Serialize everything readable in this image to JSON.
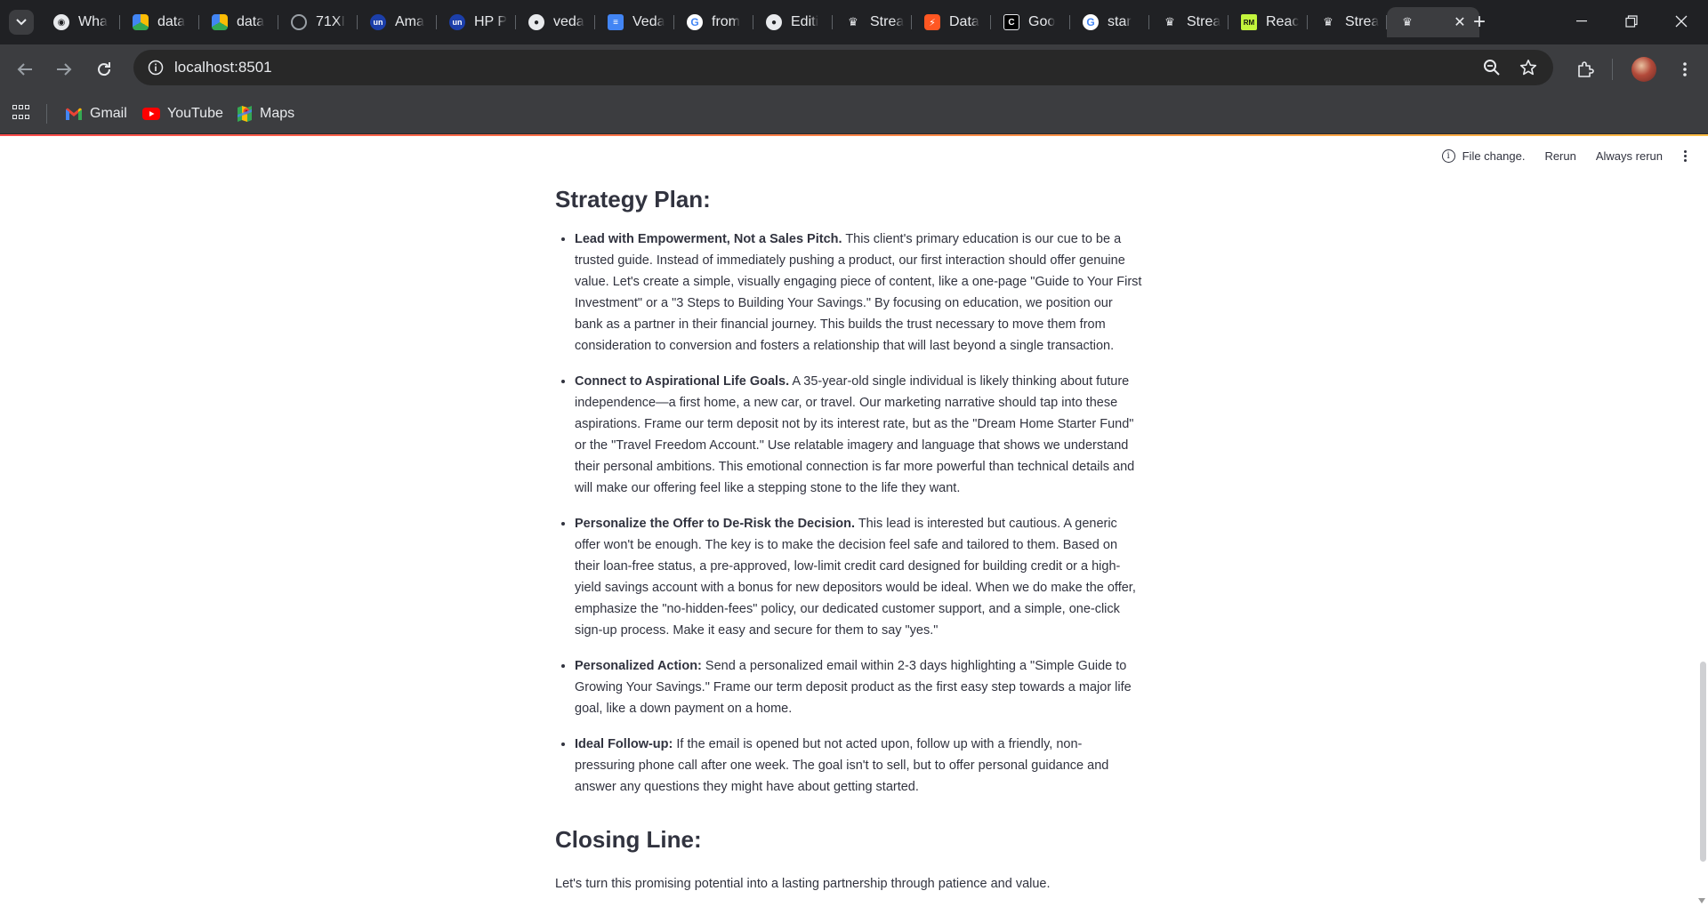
{
  "browser": {
    "tabs": [
      {
        "title": "Wha",
        "icon": "chrome-icon"
      },
      {
        "title": "data",
        "icon": "google-drive-icon"
      },
      {
        "title": "data",
        "icon": "google-drive-icon"
      },
      {
        "title": "71XI",
        "icon": "loading-icon"
      },
      {
        "title": "Ama",
        "icon": "unstop-icon"
      },
      {
        "title": "HP P",
        "icon": "unstop-icon"
      },
      {
        "title": "veda",
        "icon": "github-icon"
      },
      {
        "title": "Veda",
        "icon": "google-docs-icon"
      },
      {
        "title": "from",
        "icon": "google-icon"
      },
      {
        "title": "Editi",
        "icon": "github-icon"
      },
      {
        "title": "Strea",
        "icon": "streamlit-icon"
      },
      {
        "title": "Data",
        "icon": "bolt-icon"
      },
      {
        "title": "Goo",
        "icon": "notion-icon"
      },
      {
        "title": "star",
        "icon": "google-icon"
      },
      {
        "title": "Strea",
        "icon": "streamlit-icon"
      },
      {
        "title": "Reac",
        "icon": "rm-icon"
      },
      {
        "title": "Strea",
        "icon": "streamlit-icon"
      },
      {
        "title": "",
        "icon": "streamlit-icon"
      }
    ],
    "address": "localhost:8501",
    "bookmarks": [
      {
        "label": "Gmail",
        "icon": "gmail-icon"
      },
      {
        "label": "YouTube",
        "icon": "youtube-icon"
      },
      {
        "label": "Maps",
        "icon": "maps-icon"
      }
    ]
  },
  "status": {
    "message": "File change.",
    "rerun": "Rerun",
    "always_rerun": "Always rerun"
  },
  "content": {
    "strategy_heading": "Strategy Plan:",
    "items": [
      {
        "bold": "Lead with Empowerment, Not a Sales Pitch.",
        "text": " This client's primary education is our cue to be a trusted guide. Instead of immediately pushing a product, our first interaction should offer genuine value. Let's create a simple, visually engaging piece of content, like a one-page \"Guide to Your First Investment\" or a \"3 Steps to Building Your Savings.\" By focusing on education, we position our bank as a partner in their financial journey. This builds the trust necessary to move them from consideration to conversion and fosters a relationship that will last beyond a single transaction."
      },
      {
        "bold": "Connect to Aspirational Life Goals.",
        "text": " A 35-year-old single individual is likely thinking about future independence—a first home, a new car, or travel. Our marketing narrative should tap into these aspirations. Frame our term deposit not by its interest rate, but as the \"Dream Home Starter Fund\" or the \"Travel Freedom Account.\" Use relatable imagery and language that shows we understand their personal ambitions. This emotional connection is far more powerful than technical details and will make our offering feel like a stepping stone to the life they want."
      },
      {
        "bold": "Personalize the Offer to De-Risk the Decision.",
        "text": " This lead is interested but cautious. A generic offer won't be enough. The key is to make the decision feel safe and tailored to them. Based on their loan-free status, a pre-approved, low-limit credit card designed for building credit or a high-yield savings account with a bonus for new depositors would be ideal. When we do make the offer, emphasize the \"no-hidden-fees\" policy, our dedicated customer support, and a simple, one-click sign-up process. Make it easy and secure for them to say \"yes.\""
      },
      {
        "bold": "Personalized Action:",
        "text": " Send a personalized email within 2-3 days highlighting a \"Simple Guide to Growing Your Savings.\" Frame our term deposit product as the first easy step towards a major life goal, like a down payment on a home."
      },
      {
        "bold": "Ideal Follow-up:",
        "text": " If the email is opened but not acted upon, follow up with a friendly, non-pressuring phone call after one week. The goal isn't to sell, but to offer personal guidance and answer any questions they might have about getting started."
      }
    ],
    "closing_heading": "Closing Line:",
    "closing_text": "Let's turn this promising potential into a lasting partnership through patience and value."
  },
  "colors": {
    "browser_dark": "#202124",
    "toolbar": "#3c3d40",
    "text": "#31333f",
    "decoration_start": "#ff4b4b",
    "decoration_end": "#ffbd45"
  }
}
